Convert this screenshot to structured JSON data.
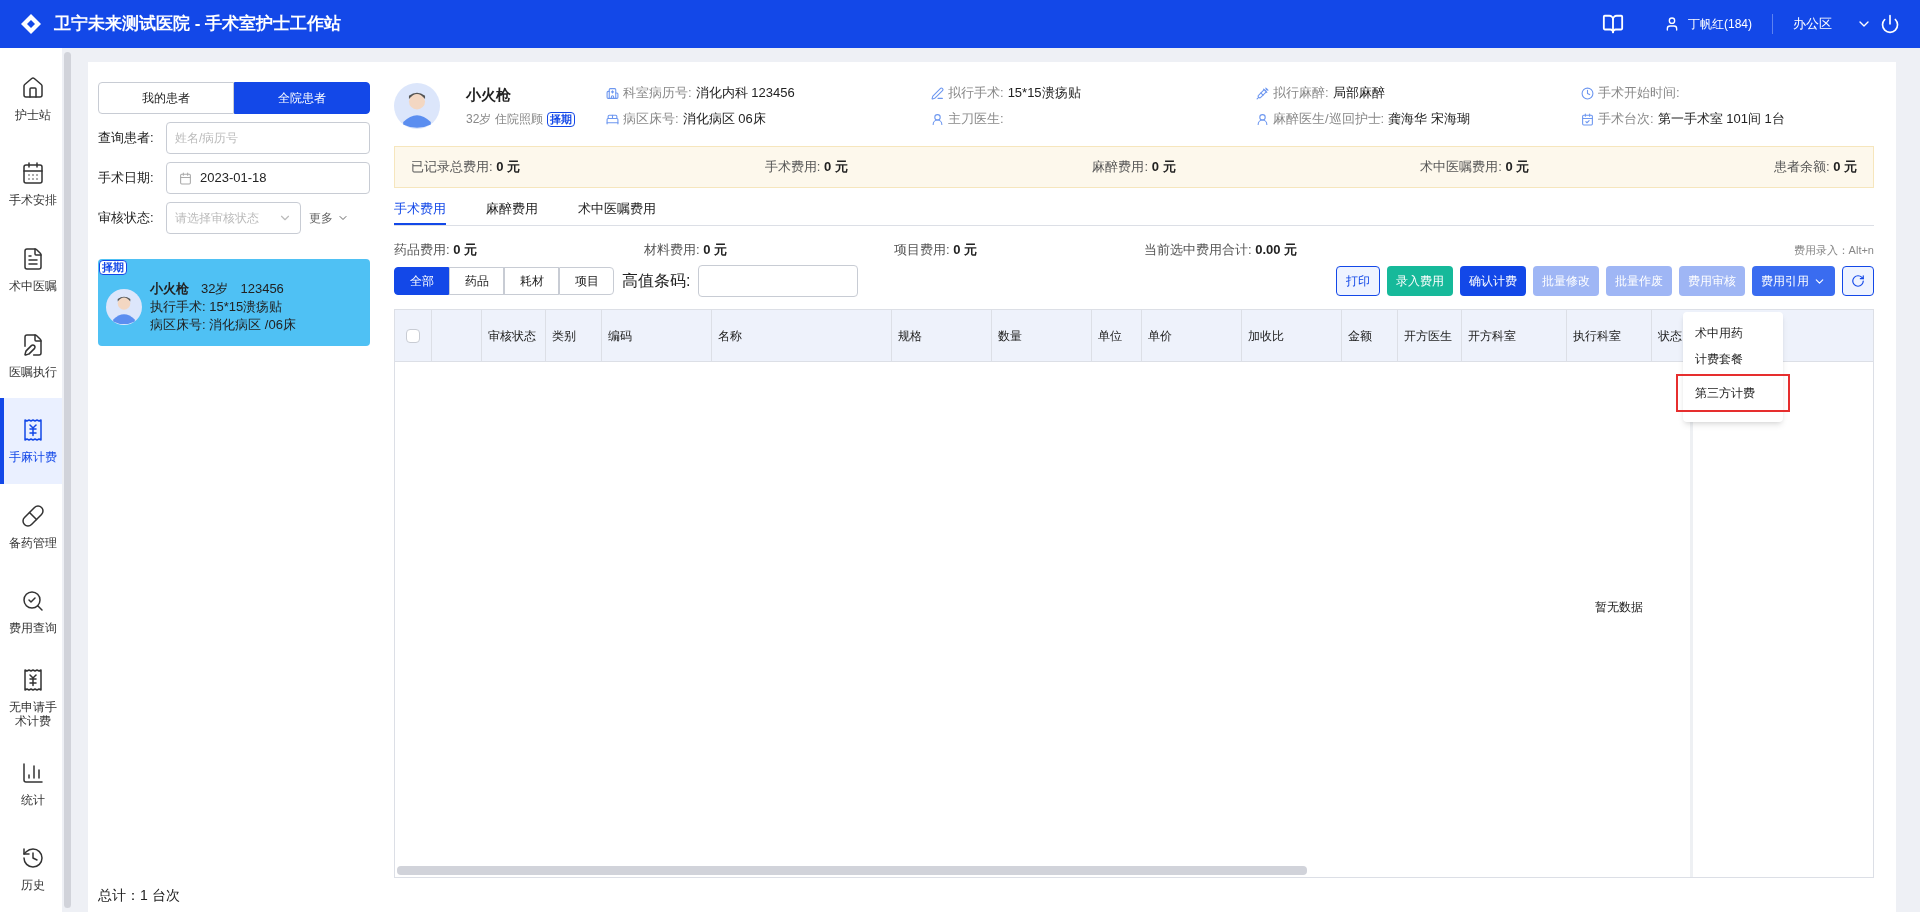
{
  "app": {
    "title": "卫宁未来测试医院 - 手术室护士工作站",
    "user": "丁帆红(184)",
    "area": "办公区"
  },
  "nav": [
    {
      "label": "护士站",
      "selected": false
    },
    {
      "label": "手术安排",
      "selected": false
    },
    {
      "label": "术中医嘱",
      "selected": false
    },
    {
      "label": "医嘱执行",
      "selected": false
    },
    {
      "label": "手麻计费",
      "selected": true
    },
    {
      "label": "备药管理",
      "selected": false
    },
    {
      "label": "费用查询",
      "selected": false
    },
    {
      "label": "无申请手术计费",
      "selected": false
    },
    {
      "label": "统计",
      "selected": false
    },
    {
      "label": "历史",
      "selected": false
    }
  ],
  "patient_tabs": [
    {
      "label": "我的患者",
      "selected": false
    },
    {
      "label": "全院患者",
      "selected": true
    }
  ],
  "filters": {
    "query": {
      "label": "查询患者:",
      "placeholder": "姓名/病历号"
    },
    "date": {
      "label": "手术日期:",
      "value": "2023-01-18"
    },
    "status": {
      "label": "审核状态:",
      "placeholder": "请选择审核状态"
    },
    "more": "更多"
  },
  "patient_cards": [
    {
      "tag": "择期",
      "name": "小火枪",
      "age": "32岁",
      "id": "123456",
      "surgery": "执行手术: 15*15溃疡贴",
      "ward": "病区床号: 消化病区 /06床",
      "selected": true
    }
  ],
  "total": "总计：1 台次",
  "patient": {
    "name": "小火枪",
    "sub": "32岁 住院照顾",
    "tag": "择期",
    "fields": [
      {
        "label": "科室病历号:",
        "value": "消化内科 123456"
      },
      {
        "label": "拟行手术:",
        "value": "15*15溃疡贴"
      },
      {
        "label": "拟行麻醉:",
        "value": "局部麻醉"
      },
      {
        "label": "手术开始时间:"
      },
      {
        "label": "病区床号:",
        "value": "消化病区 06床"
      },
      {
        "label": "主刀医生:"
      },
      {
        "label": "麻醉医生/巡回护士:",
        "value": "龚海华 宋海瑚"
      },
      {
        "label": "手术台次:",
        "value": "第一手术室 101间 1台"
      }
    ]
  },
  "fee_summary": [
    {
      "label": "已记录总费用:",
      "value": "0 元"
    },
    {
      "label": "手术费用:",
      "value": "0 元"
    },
    {
      "label": "麻醉费用:",
      "value": "0 元"
    },
    {
      "label": "术中医嘱费用:",
      "value": "0 元"
    },
    {
      "label": "患者余额:",
      "value": "0 元"
    }
  ],
  "fee_tabs": [
    {
      "label": "手术费用",
      "selected": true
    },
    {
      "label": "麻醉费用",
      "selected": false
    },
    {
      "label": "术中医嘱费用",
      "selected": false
    }
  ],
  "sub_fees": [
    {
      "label": "药品费用:",
      "value": "0 元"
    },
    {
      "label": "材料费用:",
      "value": "0 元"
    },
    {
      "label": "项目费用:",
      "value": "0 元"
    },
    {
      "label": "当前选中费用合计:",
      "value": "0.00 元"
    }
  ],
  "shortcut": "费用录入：Alt+n",
  "type_filters": [
    {
      "label": "全部",
      "selected": true
    },
    {
      "label": "药品",
      "selected": false
    },
    {
      "label": "耗材",
      "selected": false
    },
    {
      "label": "项目",
      "selected": false
    }
  ],
  "barcode": {
    "label": "高值条码:"
  },
  "actions": [
    {
      "label": "打印",
      "kind": "outline"
    },
    {
      "label": "录入费用",
      "kind": "success"
    },
    {
      "label": "确认计费",
      "kind": "primary"
    },
    {
      "label": "批量修改",
      "kind": "disabled"
    },
    {
      "label": "批量作废",
      "kind": "disabled"
    },
    {
      "label": "费用审核",
      "kind": "disabled"
    },
    {
      "label": "费用引用",
      "kind": "dropdown"
    }
  ],
  "table": {
    "select_all": {
      "checked": false
    },
    "columns": [
      "审核状态",
      "类别",
      "编码",
      "名称",
      "规格",
      "数量",
      "单位",
      "单价",
      "加收比",
      "金额",
      "开方医生",
      "开方科室",
      "执行科室",
      "状态"
    ],
    "empty": "暂无数据"
  },
  "dropdown": {
    "items": [
      {
        "label": "术中用药",
        "highlighted": false
      },
      {
        "label": "计费套餐",
        "highlighted": false
      },
      {
        "label": "第三方计费",
        "highlighted": true
      }
    ]
  }
}
